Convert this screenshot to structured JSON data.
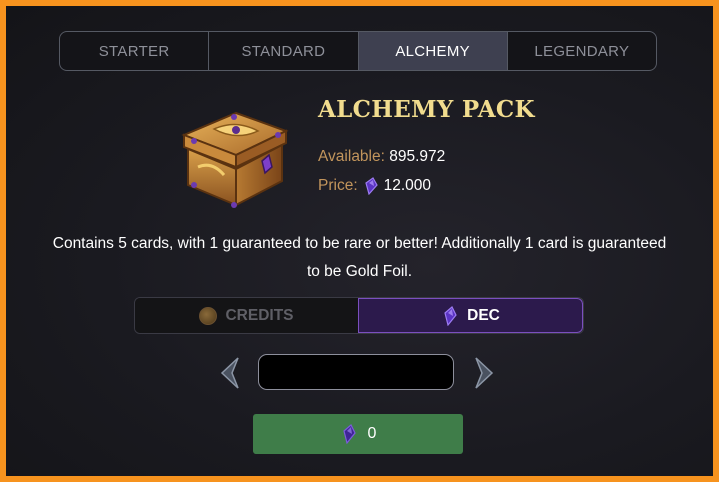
{
  "tabs": [
    {
      "label": "STARTER",
      "active": false
    },
    {
      "label": "STANDARD",
      "active": false
    },
    {
      "label": "ALCHEMY",
      "active": true
    },
    {
      "label": "LEGENDARY",
      "active": false
    }
  ],
  "pack": {
    "title": "ALCHEMY PACK",
    "available_label": "Available:",
    "available_value": "895.972",
    "price_label": "Price:",
    "price_value": "12.000",
    "price_icon": "dec-crystal-icon"
  },
  "description": "Contains 5 cards, with 1 guaranteed to be rare or better! Additionally 1 card is guaranteed to be Gold Foil.",
  "currency": {
    "credits_label": "CREDITS",
    "credits_icon": "credits-coin-icon",
    "dec_label": "DEC",
    "dec_icon": "dec-crystal-icon",
    "selected": "DEC"
  },
  "quantity": {
    "value": ""
  },
  "buy": {
    "total": "0",
    "icon": "dec-crystal-icon"
  },
  "colors": {
    "frame_border": "#f7931e",
    "title": "#f1dc8e",
    "label": "#c2955c",
    "dec_accent": "#7b4fbf",
    "buy_button": "#3f7d49"
  }
}
